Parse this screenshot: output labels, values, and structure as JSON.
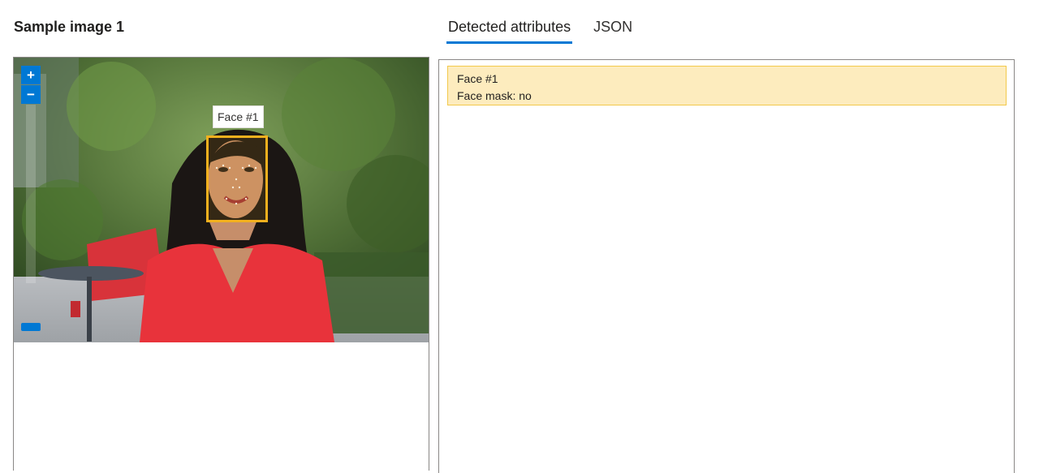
{
  "sample": {
    "title": "Sample image 1"
  },
  "tabs": [
    {
      "label": "Detected attributes",
      "active": true
    },
    {
      "label": "JSON",
      "active": false
    }
  ],
  "viewer": {
    "zoom_in_label": "+",
    "zoom_out_label": "−",
    "zoom_level": 0.0,
    "face_label": "Face #1"
  },
  "results": {
    "faces": [
      {
        "name": "Face #1",
        "attribute": "Face mask: no"
      }
    ]
  },
  "colors": {
    "accent": "#0078d4",
    "face_box": "#f2b01e",
    "highlight_bg": "#fdecbe"
  }
}
